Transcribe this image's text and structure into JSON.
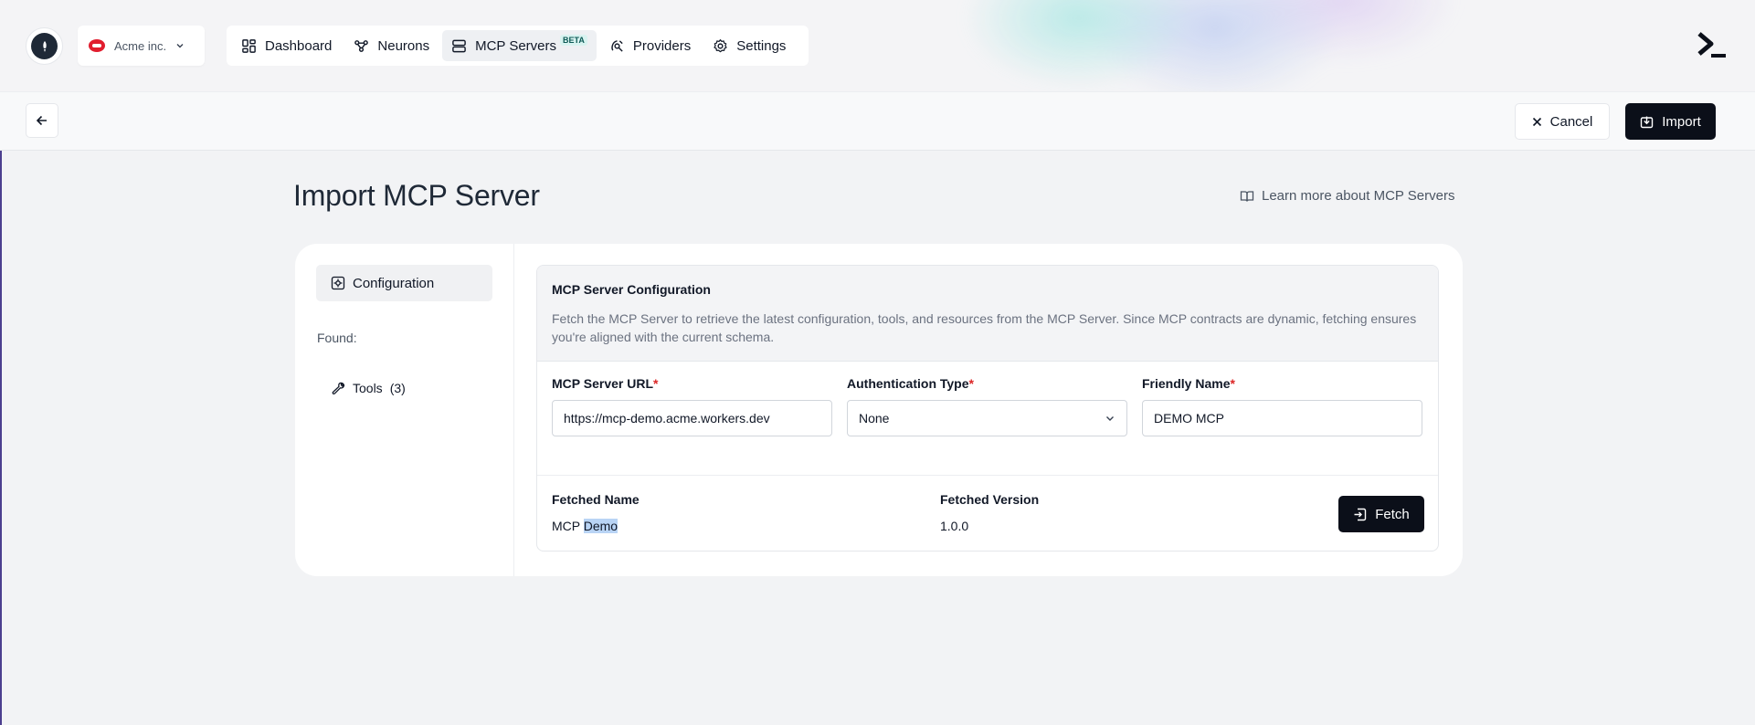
{
  "org": {
    "name": "Acme inc."
  },
  "nav": {
    "items": [
      {
        "label": "Dashboard",
        "icon": "dashboard-icon"
      },
      {
        "label": "Neurons",
        "icon": "neurons-icon"
      },
      {
        "label": "MCP Servers",
        "icon": "server-icon",
        "badge": "BETA",
        "active": true
      },
      {
        "label": "Providers",
        "icon": "providers-icon"
      },
      {
        "label": "Settings",
        "icon": "gear-icon"
      }
    ]
  },
  "actions": {
    "cancel": "Cancel",
    "import": "Import"
  },
  "page": {
    "title": "Import MCP Server",
    "learn_more": "Learn more about MCP Servers"
  },
  "sidebar": {
    "tab": "Configuration",
    "found_label": "Found:",
    "tools_label": "Tools",
    "tools_count": "(3)"
  },
  "config": {
    "title": "MCP Server Configuration",
    "description": "Fetch the MCP Server to retrieve the latest configuration, tools, and resources from the MCP Server. Since MCP contracts are dynamic, fetching ensures you're aligned with the current schema.",
    "url_label": "MCP Server URL",
    "url_value": "https://mcp-demo.acme.workers.dev",
    "auth_label": "Authentication Type",
    "auth_value": "None",
    "name_label": "Friendly Name",
    "name_value": "DEMO MCP",
    "required_mark": "*"
  },
  "fetched": {
    "name_label": "Fetched Name",
    "name_value_prefix": "MCP ",
    "name_value_selected": "Demo",
    "version_label": "Fetched Version",
    "version_value": "1.0.0",
    "fetch_button": "Fetch"
  },
  "colors": {
    "primary": "#0b0f19",
    "required": "#dc2626",
    "beta_bg": "#d8f3f0",
    "selection": "#b9d4f5"
  }
}
